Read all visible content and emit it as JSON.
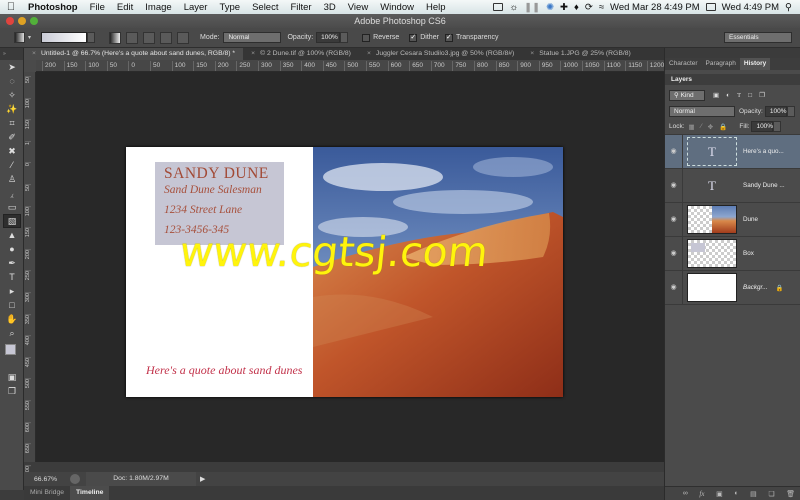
{
  "menubar": {
    "app_name": "Photoshop",
    "items": [
      "File",
      "Edit",
      "Image",
      "Layer",
      "Type",
      "Select",
      "Filter",
      "3D",
      "View",
      "Window",
      "Help"
    ],
    "clock_main": "Wed Mar 28  4:49 PM",
    "clock_secondary": "Wed 4:49 PM"
  },
  "window": {
    "title": "Adobe Photoshop CS6"
  },
  "options": {
    "mode_label": "Mode:",
    "mode_value": "Normal",
    "opacity_label": "Opacity:",
    "opacity_value": "100%",
    "reverse_label": "Reverse",
    "reverse_checked": false,
    "dither_label": "Dither",
    "dither_checked": true,
    "transparency_label": "Transparency",
    "transparency_checked": true,
    "workspace": "Essentials"
  },
  "doc_tabs": [
    {
      "label": "Untitled-1 @ 66.7% (Here's a quote about sand dunes, RGB/8) *",
      "active": true
    },
    {
      "label": "© 2 Dune.tif @ 100% (RGB/8)",
      "active": false
    },
    {
      "label": "Juggler Cesara Studilo3.jpg @ 50% (RGB/8#)",
      "active": false
    },
    {
      "label": "Statue 1.JPG @ 25% (RGB/8)",
      "active": false
    }
  ],
  "ruler_top": [
    "200",
    "150",
    "100",
    "50",
    "0",
    "50",
    "100",
    "150",
    "200",
    "250",
    "300",
    "350",
    "400",
    "450",
    "500",
    "550",
    "600",
    "650",
    "700",
    "750",
    "800",
    "850",
    "900",
    "950",
    "1000",
    "1050",
    "1100",
    "1150",
    "1200",
    "12"
  ],
  "ruler_left": [
    "50",
    "100",
    "150",
    "1",
    "0",
    "50",
    "100",
    "150",
    "200",
    "250",
    "300",
    "350",
    "400",
    "450",
    "500",
    "550",
    "600",
    "650",
    "700"
  ],
  "tools": [
    {
      "name": "move-tool",
      "glyph": "➤"
    },
    {
      "name": "marquee-tool",
      "glyph": "◌"
    },
    {
      "name": "lasso-tool",
      "glyph": "✧"
    },
    {
      "name": "quick-selection-tool",
      "glyph": "✨"
    },
    {
      "name": "crop-tool",
      "glyph": "⌗"
    },
    {
      "name": "eyedropper-tool",
      "glyph": "✐"
    },
    {
      "name": "healing-brush-tool",
      "glyph": "✖"
    },
    {
      "name": "brush-tool",
      "glyph": "⁄"
    },
    {
      "name": "clone-stamp-tool",
      "glyph": "♙"
    },
    {
      "name": "history-brush-tool",
      "glyph": "⁁"
    },
    {
      "name": "eraser-tool",
      "glyph": "▭"
    },
    {
      "name": "gradient-tool",
      "glyph": "▧",
      "active": true
    },
    {
      "name": "blur-tool",
      "glyph": "▲"
    },
    {
      "name": "dodge-tool",
      "glyph": "●"
    },
    {
      "name": "pen-tool",
      "glyph": "✒"
    },
    {
      "name": "type-tool",
      "glyph": "T"
    },
    {
      "name": "path-selection-tool",
      "glyph": "▸"
    },
    {
      "name": "rectangle-tool",
      "glyph": "□"
    },
    {
      "name": "hand-tool",
      "glyph": "✋"
    },
    {
      "name": "zoom-tool",
      "glyph": "⌕"
    }
  ],
  "canvas": {
    "card_name": "SANDY DUNE",
    "card_lines": [
      "Sand Dune Salesman",
      "1234 Street Lane",
      "123-3456-345"
    ],
    "quote": "Here's a quote about sand dunes",
    "watermark": "www.cgtsj.com",
    "colors": {
      "name": "#a24a36",
      "quote": "#c2324a",
      "box": "#c6c6d4",
      "watermark": "#fff40c"
    }
  },
  "status": {
    "zoom": "66.67%",
    "doc": "Doc: 1.80M/2.97M"
  },
  "bottom_tabs": [
    {
      "label": "Mini Bridge",
      "active": false
    },
    {
      "label": "Timeline",
      "active": true
    }
  ],
  "panels": {
    "tabs": [
      {
        "label": "Character",
        "active": false
      },
      {
        "label": "Paragraph",
        "active": false
      },
      {
        "label": "History",
        "active": true
      }
    ],
    "layers_title": "Layers",
    "filter_kind": "Kind",
    "blend_mode": "Normal",
    "opacity_label": "Opacity:",
    "opacity_value": "100%",
    "lock_label": "Lock:",
    "fill_label": "Fill:",
    "fill_value": "100%",
    "layers": [
      {
        "name": "Here's a quo...",
        "kind": "type",
        "selected": true,
        "locked": false
      },
      {
        "name": "Sandy Dune ...",
        "kind": "type",
        "selected": false,
        "locked": false
      },
      {
        "name": "Dune",
        "kind": "image",
        "selected": false,
        "locked": false
      },
      {
        "name": "Box",
        "kind": "shape",
        "selected": false,
        "locked": false
      },
      {
        "name": "Backgr...",
        "kind": "background",
        "selected": false,
        "locked": true
      }
    ],
    "footer_icons": [
      "link-layers-icon",
      "fx-icon",
      "mask-icon",
      "adjustment-icon",
      "group-icon",
      "new-layer-icon",
      "trash-icon"
    ]
  }
}
